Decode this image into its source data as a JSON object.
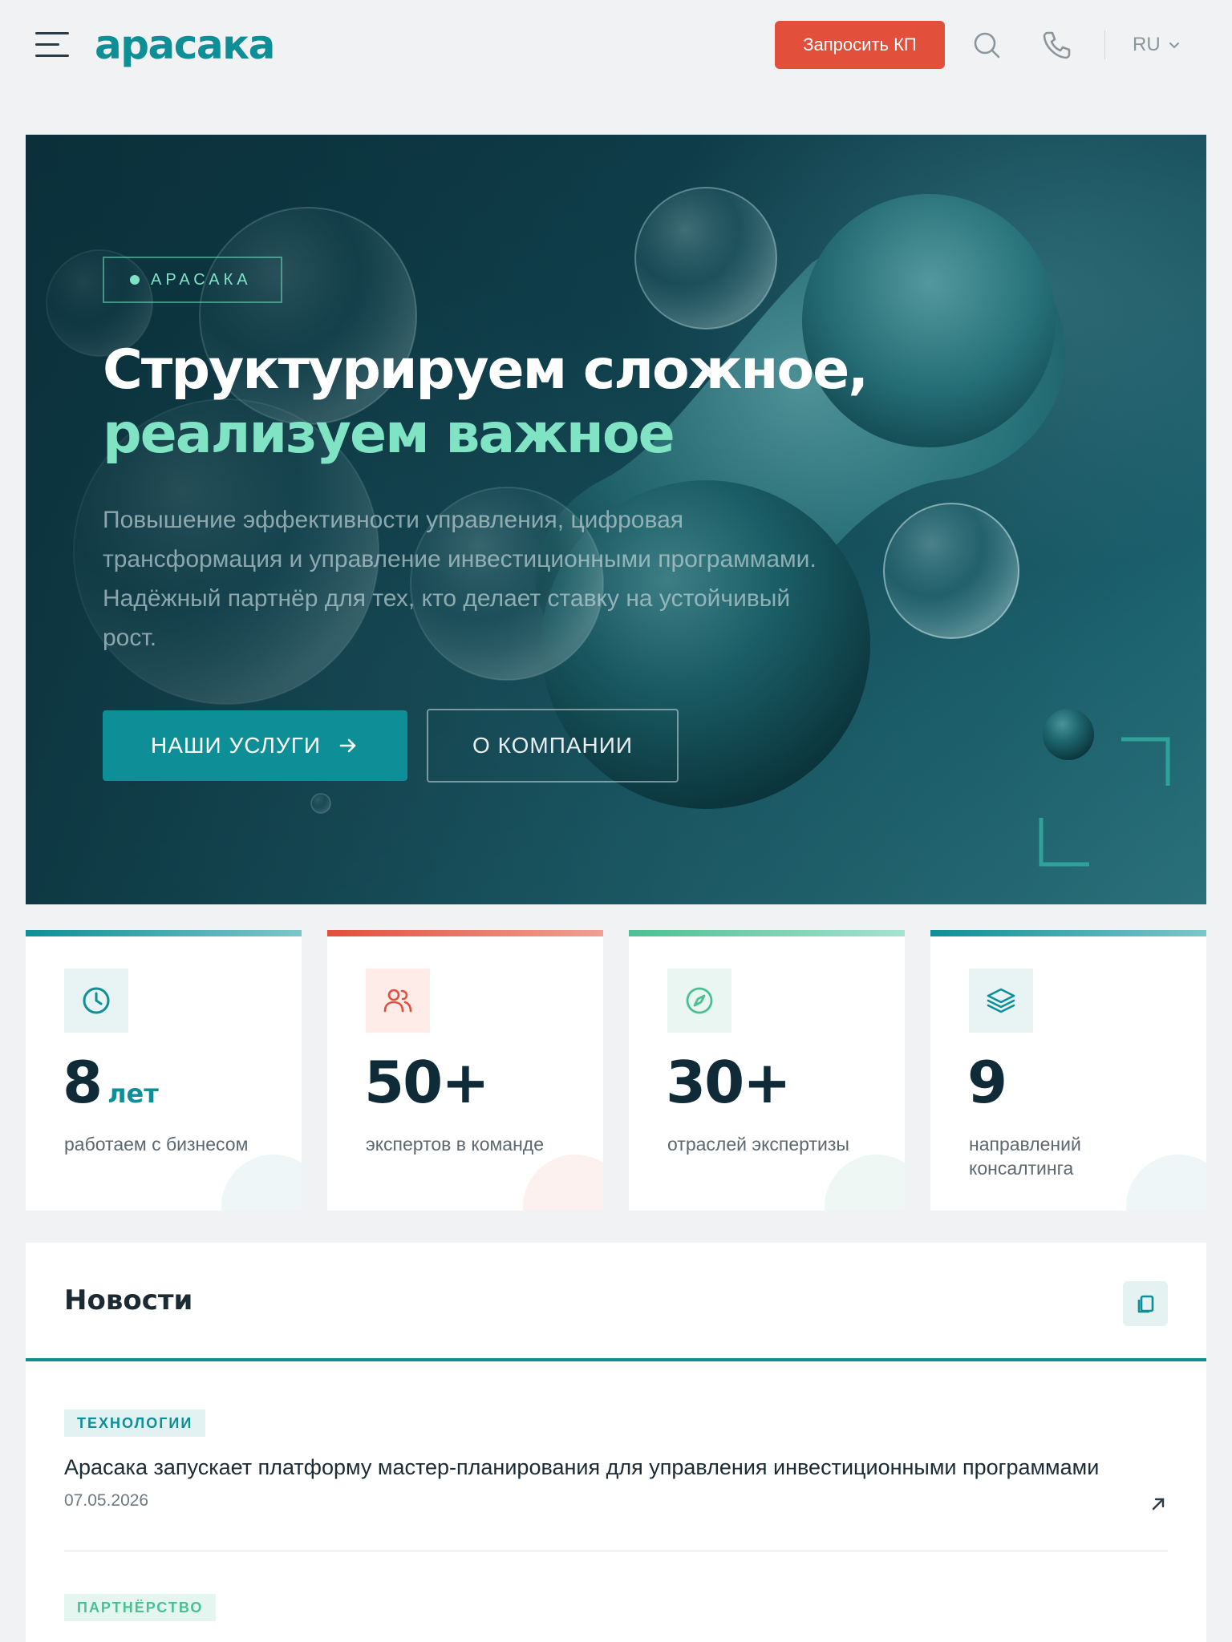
{
  "header": {
    "logo": "арасака",
    "cta_label": "Запросить КП",
    "language": "RU",
    "icons": [
      "menu-icon",
      "search-icon",
      "phone-icon",
      "chevron-down-icon"
    ]
  },
  "hero": {
    "tag": "АРАСАКА",
    "title_line1": "Структурируем сложное,",
    "title_line2": "реализуем важное",
    "subtitle": "Повышение эффективности управления, цифровая трансформация и управление инвестиционными программами. Надёжный партнёр для тех, кто делает ставку на устойчивый рост.",
    "primary_button": "НАШИ УСЛУГИ",
    "secondary_button": "О КОМПАНИИ"
  },
  "stats": [
    {
      "icon": "clock-icon",
      "value": "8",
      "unit": "лет",
      "label": "работаем с бизнесом",
      "accent": "#0e8f97"
    },
    {
      "icon": "users-icon",
      "value": "50+",
      "unit": "",
      "label": "экспертов в команде",
      "accent": "#e2503b"
    },
    {
      "icon": "compass-icon",
      "value": "30+",
      "unit": "",
      "label": "отраслей экспертизы",
      "accent": "#4cbf94"
    },
    {
      "icon": "layers-icon",
      "value": "9",
      "unit": "",
      "label": "направлений консалтинга",
      "accent": "#0e8f97"
    }
  ],
  "news": {
    "title": "Новости",
    "items": [
      {
        "category": "ТЕХНОЛОГИИ",
        "title": "Арасака запускает платформу мастер-планирования для управления инвестиционными программами",
        "date": "07.05.2026"
      },
      {
        "category": "ПАРТНЁРСТВО",
        "title": "",
        "date": ""
      }
    ]
  },
  "colors": {
    "brand": "#0e8f97",
    "cta": "#e2503b",
    "mint": "#7fe3c4",
    "hero_dark": "#0d3945"
  }
}
